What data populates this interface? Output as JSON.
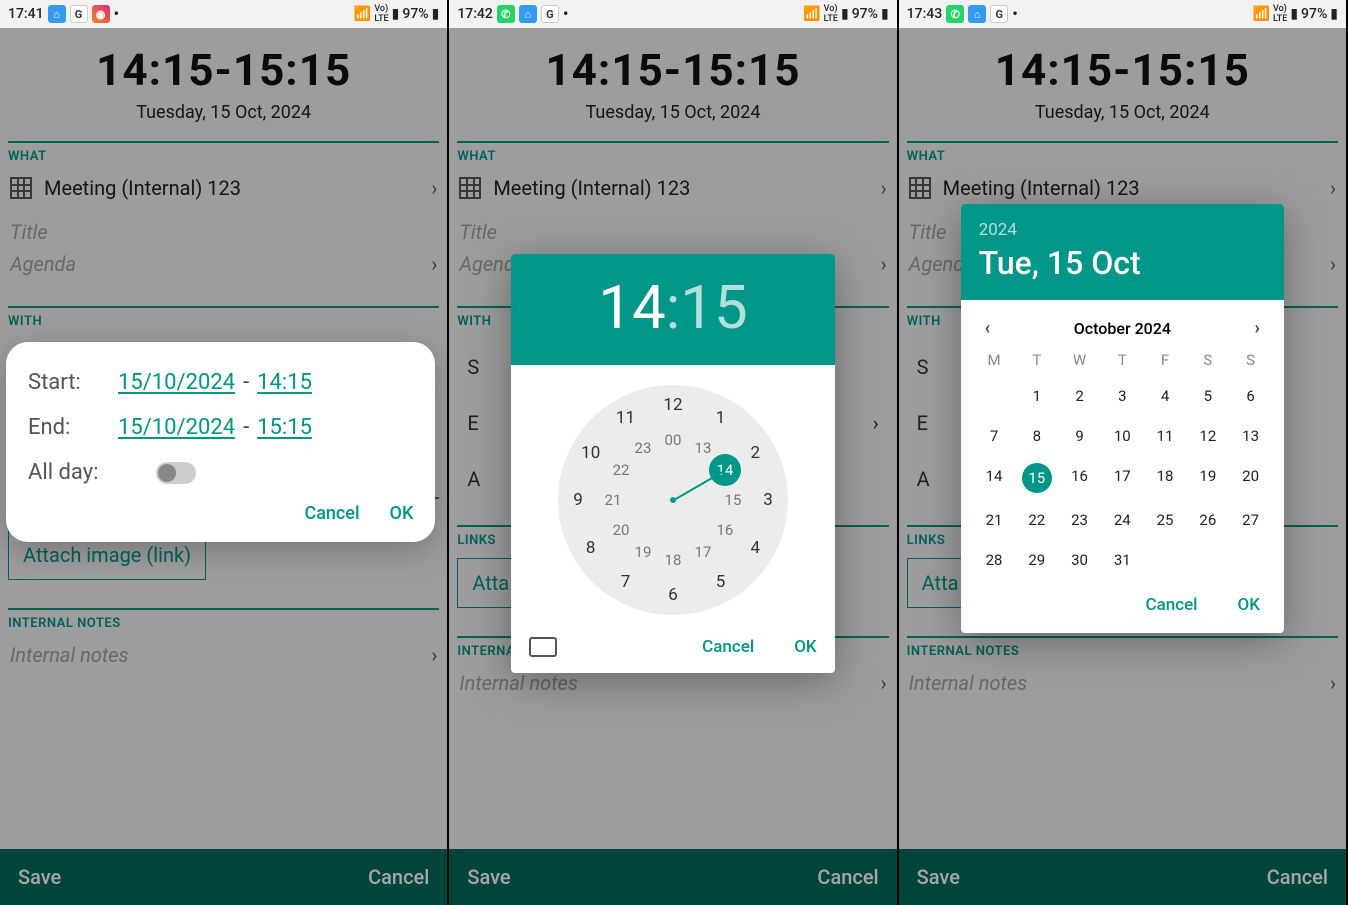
{
  "screens": [
    {
      "status_time": "17:41",
      "icons": [
        "app-blue",
        "G",
        "ig"
      ],
      "battery": "97%"
    },
    {
      "status_time": "17:42",
      "icons": [
        "wa",
        "app-blue",
        "G"
      ],
      "battery": "97%"
    },
    {
      "status_time": "17:43",
      "icons": [
        "wa",
        "app-blue",
        "G"
      ],
      "battery": "97%"
    }
  ],
  "event": {
    "time_range": "14:15-15:15",
    "date_line": "Tuesday, 15 Oct, 2024",
    "what_label": "WHAT",
    "type_value": "Meeting (Internal) 123",
    "title_placeholder": "Title",
    "agenda_placeholder": "Agenda",
    "with_label": "WITH",
    "with_start_letters": [
      "S",
      "E",
      "A"
    ],
    "links_label": "LINKS",
    "attach_label": "Attach image (link)",
    "notes_label": "INTERNAL NOTES",
    "notes_placeholder": "Internal notes",
    "save_label": "Save",
    "cancel_label": "Cancel"
  },
  "dialog_startend": {
    "start_label": "Start:",
    "start_date": "15/10/2024",
    "start_time": "14:15",
    "end_label": "End:",
    "end_date": "15/10/2024",
    "end_time": "15:15",
    "allday_label": "All day:",
    "allday_value": false,
    "cancel": "Cancel",
    "ok": "OK"
  },
  "dialog_clock": {
    "hour": "14",
    "minute": "15",
    "selected_inner_hour": 14,
    "outer_numbers": [
      12,
      1,
      2,
      3,
      4,
      5,
      6,
      7,
      8,
      9,
      10,
      11
    ],
    "inner_numbers": [
      "00",
      13,
      14,
      15,
      16,
      17,
      18,
      19,
      20,
      21,
      22,
      23
    ],
    "cancel": "Cancel",
    "ok": "OK"
  },
  "dialog_date": {
    "year": "2024",
    "header_date": "Tue, 15 Oct",
    "month_label": "October 2024",
    "dow": [
      "M",
      "T",
      "W",
      "T",
      "F",
      "S",
      "S"
    ],
    "days": [
      [
        null,
        1,
        2,
        3,
        4,
        5,
        6
      ],
      [
        7,
        8,
        9,
        10,
        11,
        12,
        13
      ],
      [
        14,
        15,
        16,
        17,
        18,
        19,
        20
      ],
      [
        21,
        22,
        23,
        24,
        25,
        26,
        27
      ],
      [
        28,
        29,
        30,
        31,
        null,
        null,
        null
      ]
    ],
    "selected_day": 15,
    "cancel": "Cancel",
    "ok": "OK"
  }
}
